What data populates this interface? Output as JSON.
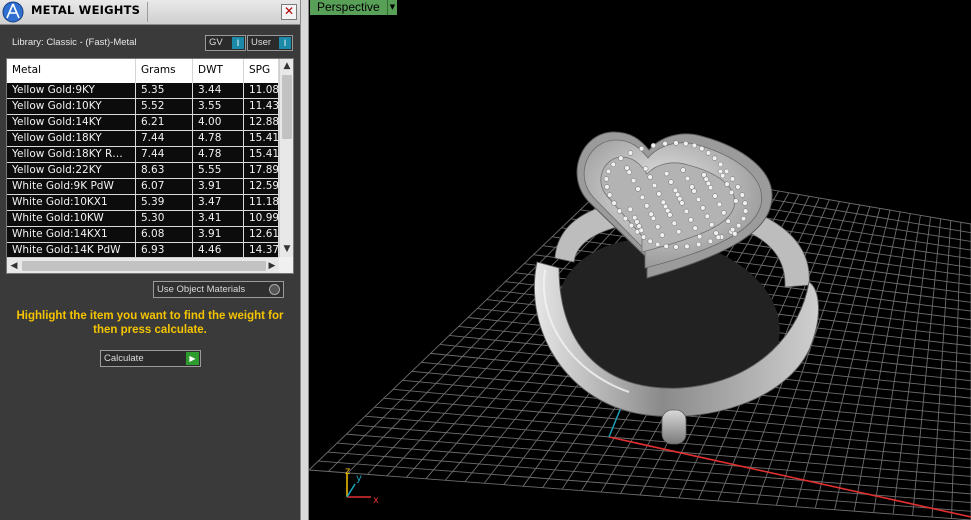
{
  "window": {
    "title": "METAL WEIGHTS",
    "close_glyph": "✕"
  },
  "library": {
    "label": "Library: Classic - (Fast)-Metal"
  },
  "filters": {
    "gv_label": "GV",
    "user_label": "User"
  },
  "table": {
    "columns": [
      "Metal",
      "Grams",
      "DWT",
      "SPG"
    ],
    "rows": [
      [
        "Yellow Gold:9KY",
        "5.35",
        "3.44",
        "11.08"
      ],
      [
        "Yellow Gold:10KY",
        "5.52",
        "3.55",
        "11.43"
      ],
      [
        "Yellow Gold:14KY",
        "6.21",
        "4.00",
        "12.88"
      ],
      [
        "Yellow Gold:18KY",
        "7.44",
        "4.78",
        "15.41"
      ],
      [
        "Yellow Gold:18KY R…",
        "7.44",
        "4.78",
        "15.41"
      ],
      [
        "Yellow Gold:22KY",
        "8.63",
        "5.55",
        "17.89"
      ],
      [
        "White Gold:9K PdW",
        "6.07",
        "3.91",
        "12.59"
      ],
      [
        "White Gold:10KX1",
        "5.39",
        "3.47",
        "11.18"
      ],
      [
        "White Gold:10KW",
        "5.30",
        "3.41",
        "10.99"
      ],
      [
        "White Gold:14KX1",
        "6.08",
        "3.91",
        "12.61"
      ],
      [
        "White Gold:14K PdW",
        "6.93",
        "4.46",
        "14.37"
      ]
    ]
  },
  "options": {
    "use_object_materials_label": "Use Object Materials"
  },
  "hint": {
    "text": "Highlight the item you want to find the weight for then press calculate."
  },
  "actions": {
    "calculate_label": "Calculate"
  },
  "viewport": {
    "view_label": "Perspective",
    "axis_x": "x",
    "axis_y": "y",
    "axis_z": "z"
  },
  "icons": {
    "logo": "app-logo-icon",
    "close": "close-icon",
    "dropdown": "chevron-down-icon",
    "go": "play-arrow-icon"
  },
  "colors": {
    "hint_text": "#f5c400",
    "view_tab": "#58a058",
    "axis_x": "#e03030",
    "axis_y": "#1aa6c0",
    "selection_row_bg": "#0c0c0c"
  }
}
